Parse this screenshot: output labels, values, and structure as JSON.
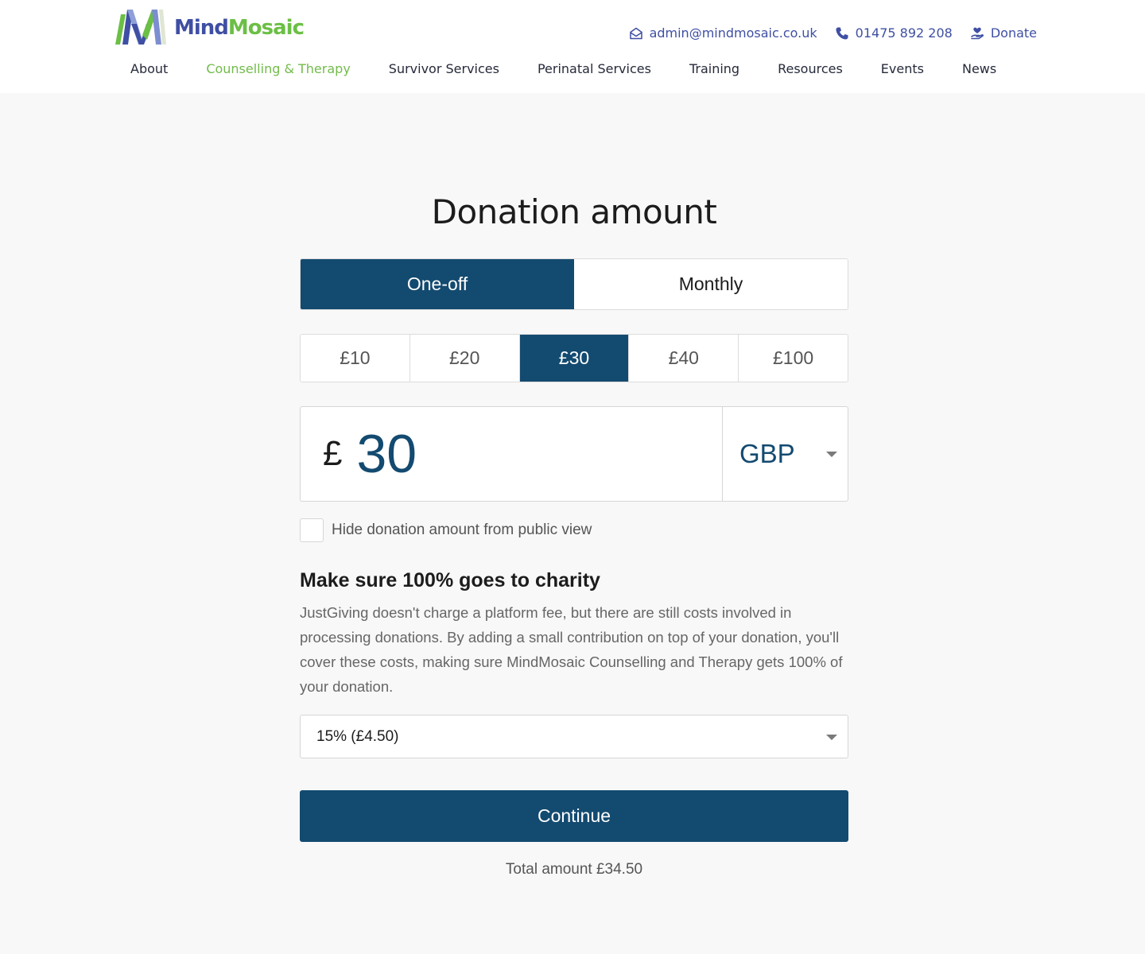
{
  "brand": {
    "name_part1": "Mind",
    "name_part2": "Mosaic",
    "colors": {
      "blue": "#3f4fa3",
      "green": "#6bbf45",
      "primary": "#134a70"
    }
  },
  "contact": {
    "email": "admin@mindmosaic.co.uk",
    "email_icon": "envelope-open-icon",
    "phone": "01475 892 208",
    "phone_icon": "phone-icon",
    "donate_label": "Donate",
    "donate_icon": "heart-in-hand-icon"
  },
  "nav": {
    "items": [
      {
        "label": "About",
        "active": false
      },
      {
        "label": "Counselling & Therapy",
        "active": true
      },
      {
        "label": "Survivor Services",
        "active": false
      },
      {
        "label": "Perinatal Services",
        "active": false
      },
      {
        "label": "Training",
        "active": false
      },
      {
        "label": "Resources",
        "active": false
      },
      {
        "label": "Events",
        "active": false
      },
      {
        "label": "News",
        "active": false
      }
    ]
  },
  "form": {
    "title": "Donation amount",
    "frequency": {
      "options": [
        "One-off",
        "Monthly"
      ],
      "selected": "One-off"
    },
    "presets": {
      "options": [
        "£10",
        "£20",
        "£30",
        "£40",
        "£100"
      ],
      "selected": "£30"
    },
    "amount": {
      "currency_symbol": "£",
      "value": "30"
    },
    "currency": {
      "selected": "GBP"
    },
    "hide_amount": {
      "label": "Hide donation amount from public view",
      "checked": false
    },
    "fee": {
      "heading": "Make sure 100% goes to charity",
      "description": "JustGiving doesn't charge a platform fee, but there are still costs involved in processing donations. By adding a small contribution on top of your donation, you'll cover these costs, making sure MindMosaic Counselling and Therapy gets 100% of your donation.",
      "selected_option": "15% (£4.50)"
    },
    "continue_label": "Continue",
    "total_label": "Total amount £34.50"
  }
}
